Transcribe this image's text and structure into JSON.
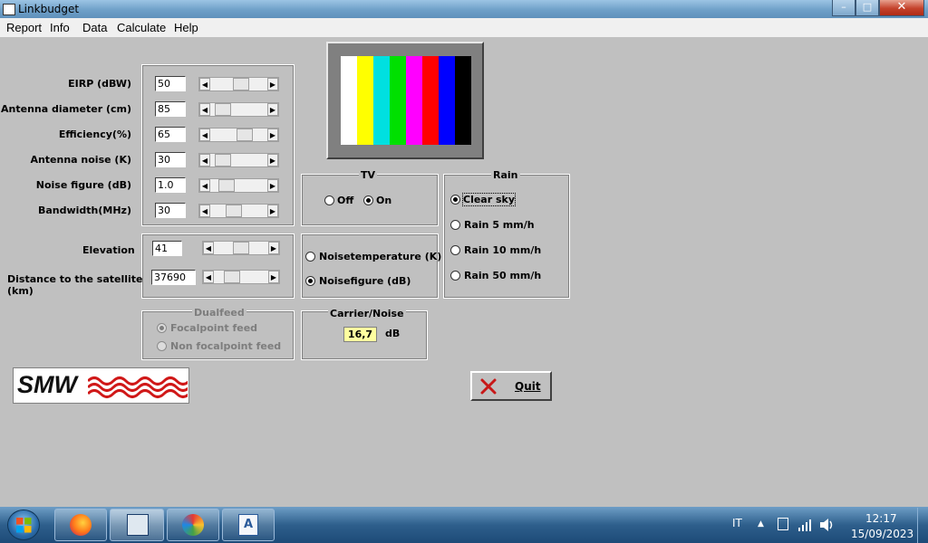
{
  "window": {
    "title": "Linkbudget",
    "minimize": "–",
    "maximize": "□",
    "close": "✕"
  },
  "menu": [
    "Report",
    "Info",
    "Data",
    "Calculate",
    "Help"
  ],
  "params": [
    {
      "label": "EIRP (dBW)",
      "value": "50",
      "slider": 0.55
    },
    {
      "label": "Antenna diameter (cm)",
      "value": "85",
      "slider": 0.12
    },
    {
      "label": "Efficiency(%)",
      "value": "65",
      "slider": 0.65
    },
    {
      "label": "Antenna noise (K)",
      "value": "30",
      "slider": 0.1
    },
    {
      "label": "Noise figure (dB)",
      "value": "1.0",
      "slider": 0.2
    },
    {
      "label": "Bandwidth(MHz)",
      "value": "30",
      "slider": 0.38
    }
  ],
  "elevation": {
    "label": "Elevation",
    "value": "41",
    "slider": 0.5
  },
  "distance": {
    "label": "Distance to the satellite (km)",
    "value": "37690",
    "slider": 0.25
  },
  "testcard": {
    "colors": [
      "#ffffff",
      "#ffff00",
      "#00e0e0",
      "#00e000",
      "#ff00ff",
      "#ff0000",
      "#0000ff",
      "#000000"
    ]
  },
  "tv": {
    "title": "TV",
    "off": "Off",
    "on": "On",
    "selected": "On"
  },
  "rain": {
    "title": "Rain",
    "options": [
      "Clear sky",
      "Rain 5 mm/h",
      "Rain 10 mm/h",
      "Rain 50 mm/h"
    ],
    "selected": "Clear sky"
  },
  "noise_mode": {
    "options": [
      "Noisetemperature (K)",
      "Noisefigure (dB)"
    ],
    "selected": "Noisefigure (dB)"
  },
  "dualfeed": {
    "title": "Dualfeed",
    "options": [
      "Focalpoint feed",
      "Non focalpoint feed"
    ],
    "selected": "Focalpoint feed"
  },
  "carrier_noise": {
    "title": "Carrier/Noise",
    "value": "16,7",
    "unit": "dB"
  },
  "logo": {
    "text": "SMW"
  },
  "quit": {
    "label": "Quit"
  },
  "taskbar": {
    "language": "IT",
    "time": "12:17",
    "date": "15/09/2023"
  }
}
